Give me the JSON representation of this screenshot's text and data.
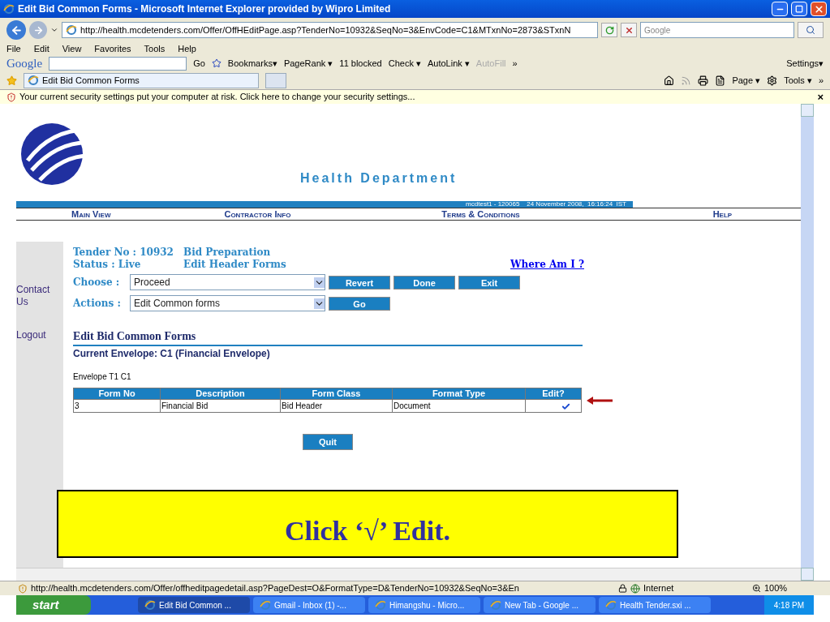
{
  "window": {
    "title": "Edit Bid Common Forms - Microsoft Internet Explorer provided by Wipro Limited"
  },
  "address_bar": {
    "url": "http://health.mcdetenders.com/Offer/OffHEditPage.asp?TenderNo=10932&SeqNo=3&EnvCode=C1&MTxnNo=2873&STxnN",
    "search_placeholder": "Google"
  },
  "menu": [
    "File",
    "Edit",
    "View",
    "Favorites",
    "Tools",
    "Help"
  ],
  "google_toolbar": {
    "brand": "Google",
    "go": "Go",
    "items": [
      "Bookmarks▾",
      "PageRank ▾",
      "11 blocked",
      "Check ▾",
      "AutoLink ▾",
      "AutoFill",
      "»"
    ],
    "settings": "Settings▾"
  },
  "tab": {
    "label": "Edit Bid Common Forms",
    "selected": true
  },
  "command_bar": [
    "Page ▾",
    "Tools ▾",
    "»"
  ],
  "security_bar": {
    "message": "Your current security settings put your computer at risk. Click here to change your security settings...",
    "close": "×"
  },
  "page": {
    "header": "Health Department",
    "info_bar": "mcdtest1 - 120065    24 November 2008,  16:16:24  IST",
    "nav": [
      "Main View",
      "Contractor Info",
      "Terms & Conditions",
      "Help"
    ],
    "sidebar": [
      "Contact Us",
      "Logout"
    ],
    "tender_no": "Tender No : 10932",
    "stage": "Bid Preparation",
    "status": "Status : Live",
    "substage": "Edit Header Forms",
    "where_link": "Where Am I ?",
    "choose": {
      "label": "Choose :",
      "value": "Proceed",
      "buttons": [
        "Revert",
        "Done",
        "Exit"
      ]
    },
    "actions": {
      "label": "Actions :",
      "value": "Edit Common forms",
      "button": "Go"
    },
    "section_title": "Edit Bid Common Forms",
    "envelope": "Current Envelope: C1 (Financial Envelope)",
    "envelope_label": "Envelope T1 C1",
    "table": {
      "columns": [
        "Form No",
        "Description",
        "Form Class",
        "Format Type",
        "Edit?"
      ],
      "rows": [
        {
          "cells": [
            "3",
            "Financial Bid",
            "Bid Header",
            "Document"
          ],
          "edit": true
        }
      ]
    },
    "quit": "Quit",
    "callout": "Click ‘√’ Edit."
  },
  "status_bar": {
    "url": "http://health.mcdetenders.com/Offer/offheditpagedetail.asp?PageDest=O&FormatType=D&TenderNo=10932&SeqNo=3&En",
    "zone": "Internet",
    "zoom": "100%"
  },
  "taskbar": {
    "start": "start",
    "tasks": [
      {
        "label": "Edit Bid Common ...",
        "selected": true
      },
      {
        "label": "Gmail - Inbox (1) -...",
        "selected": false
      },
      {
        "label": "Himangshu - Micro...",
        "selected": false
      },
      {
        "label": "New Tab - Google ...",
        "selected": false
      },
      {
        "label": "Health Tender.sxi ...",
        "selected": false
      }
    ],
    "clock": "4:18 PM"
  }
}
